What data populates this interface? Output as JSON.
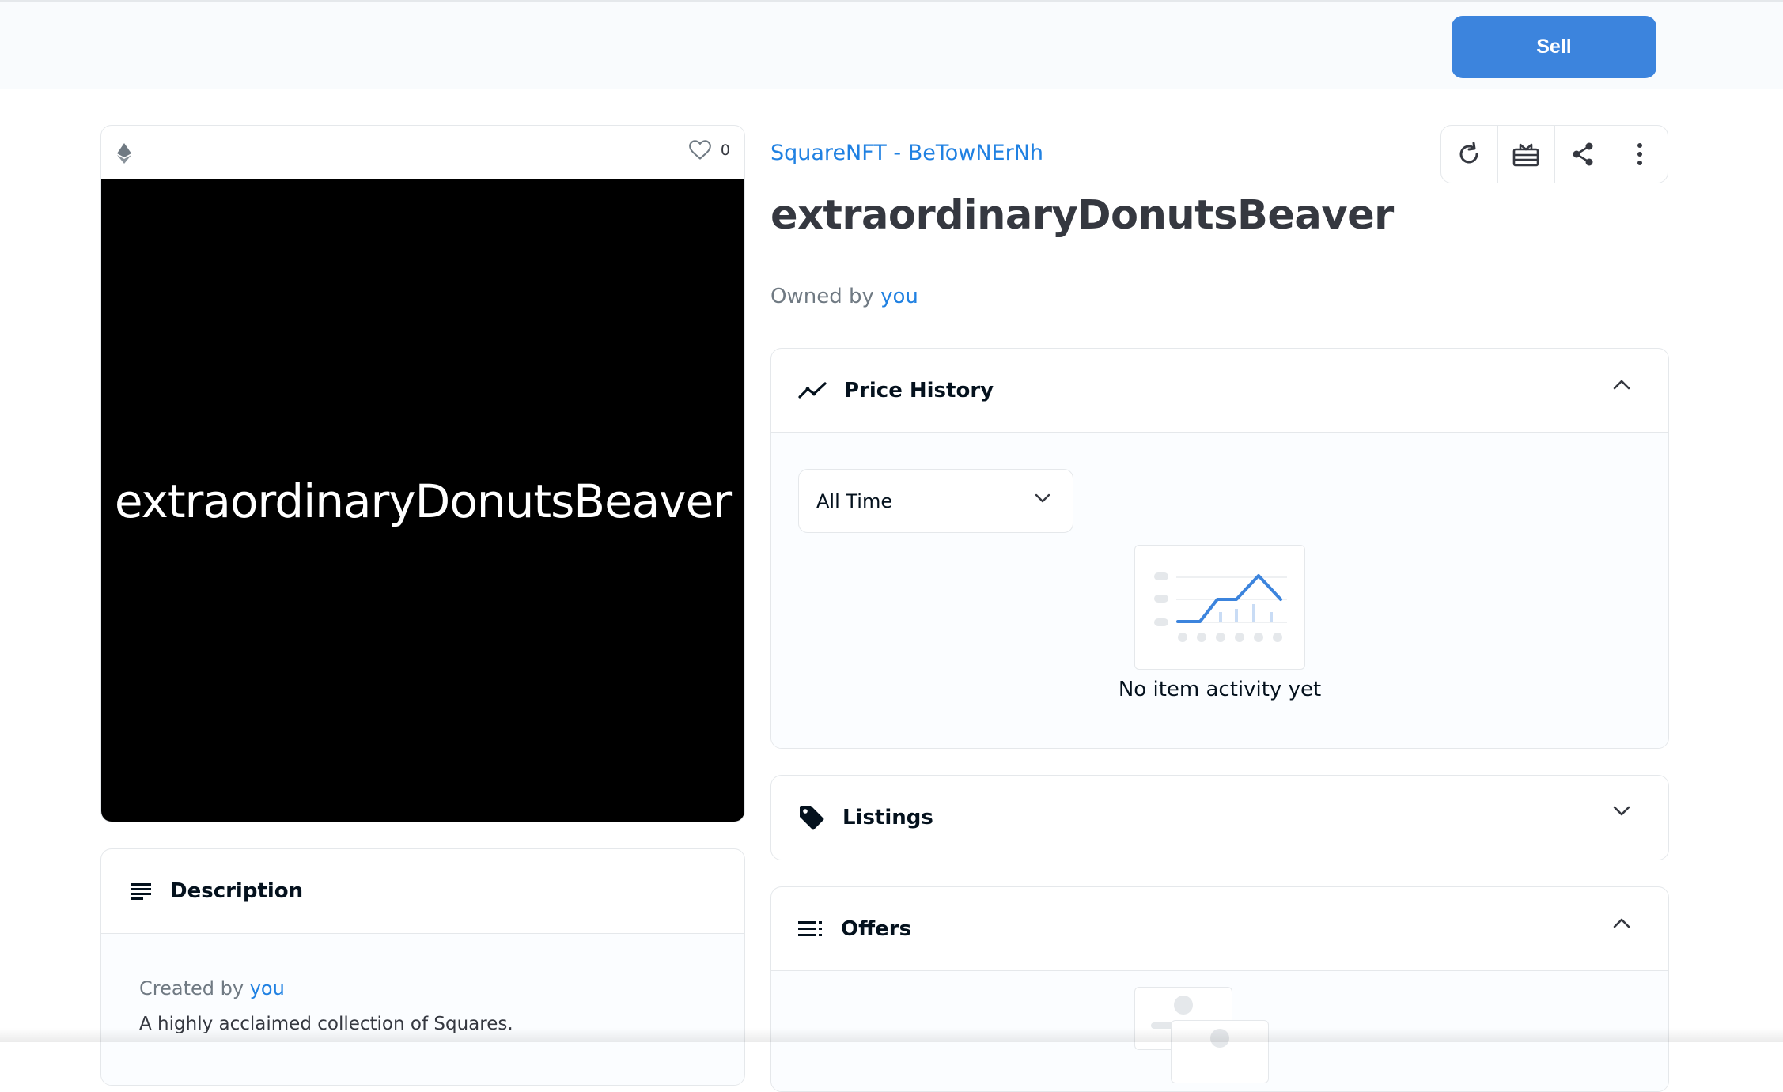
{
  "header": {
    "sell_label": "Sell"
  },
  "asset": {
    "favorite_count": "0",
    "image_text": "extraordinaryDonutsBeaver",
    "collection_name": "SquareNFT - BeTowNErNh",
    "title": "extraordinaryDonutsBeaver",
    "owned_by_prefix": "Owned by",
    "owner": "you"
  },
  "description": {
    "title": "Description",
    "created_by_prefix": "Created by",
    "creator": "you",
    "text": "A highly acclaimed collection of Squares."
  },
  "price_history": {
    "title": "Price History",
    "range_selected": "All Time",
    "empty_text": "No item activity yet"
  },
  "listings": {
    "title": "Listings"
  },
  "offers": {
    "title": "Offers"
  },
  "icons": {
    "eth": "ethereum-icon",
    "favorite": "heart-icon",
    "refresh": "refresh-icon",
    "transfer": "gift-icon",
    "share": "share-icon",
    "more": "more-vertical-icon",
    "price_history": "trend-line-icon",
    "listings": "tag-icon",
    "offers": "list-icon",
    "description": "text-lines-icon"
  },
  "colors": {
    "accent": "#2081e2",
    "button": "#3c84dd",
    "text": "#04111d",
    "muted": "#707a83"
  }
}
